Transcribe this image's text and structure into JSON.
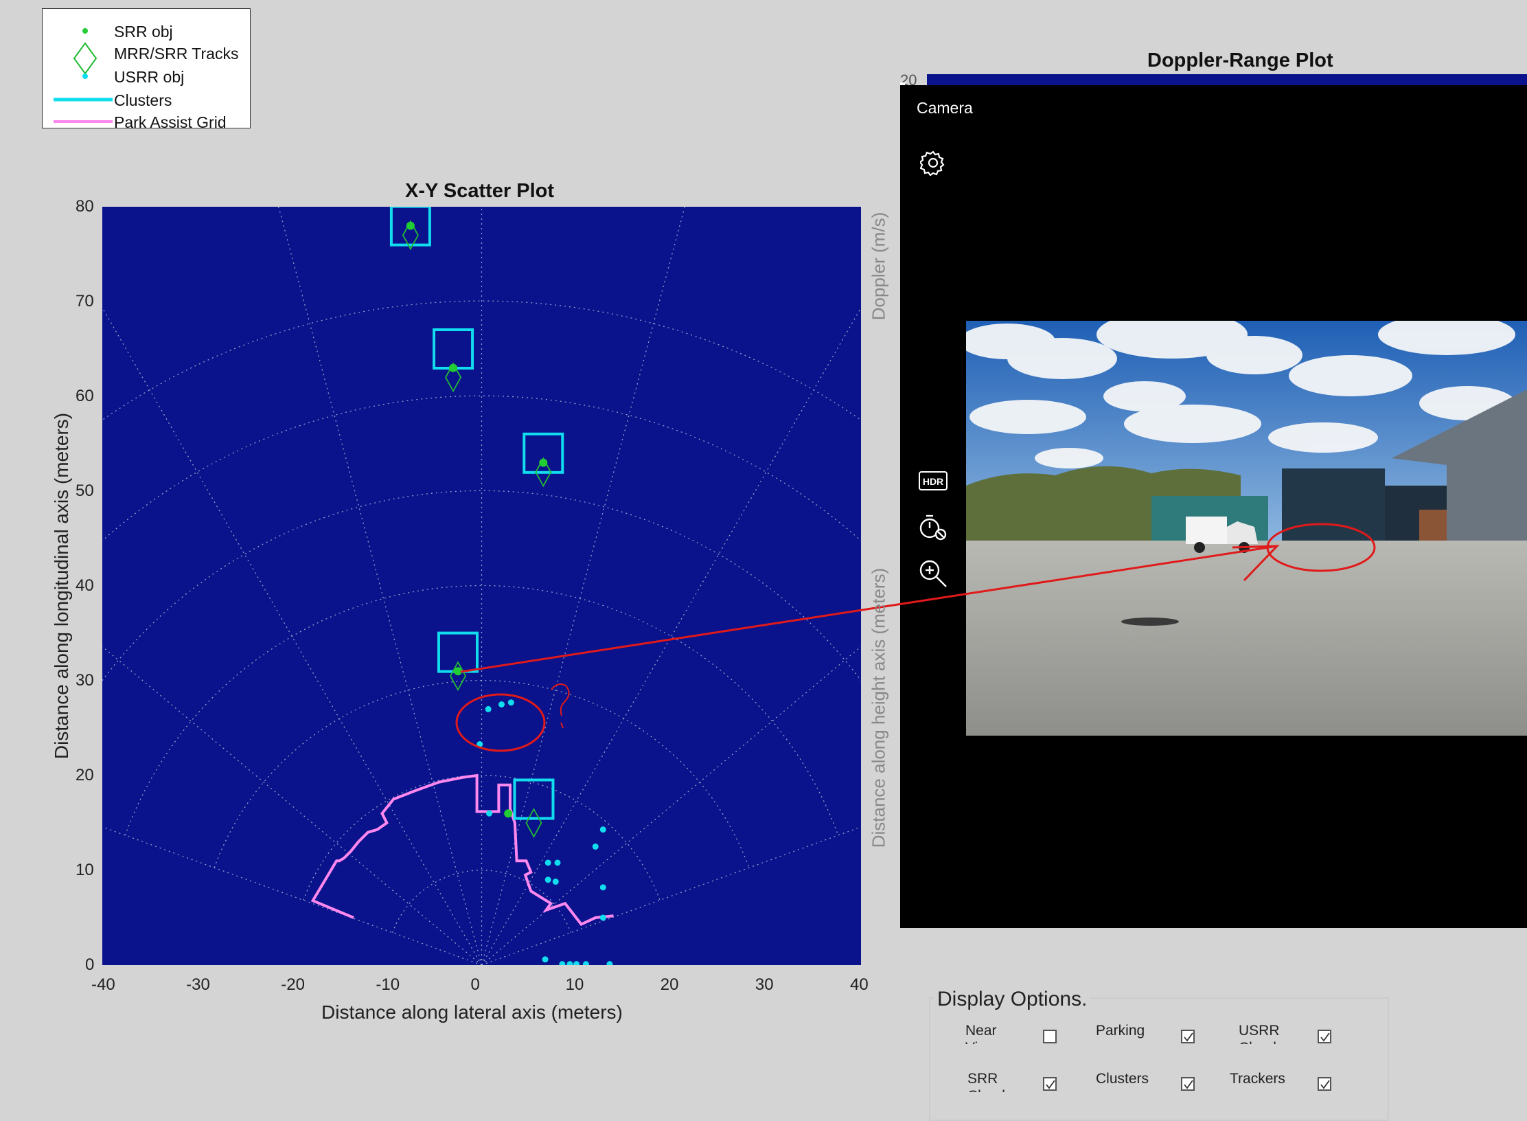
{
  "legend": {
    "items": [
      {
        "label": "SRR obj",
        "icon": "green-dot"
      },
      {
        "label": "MRR/SRR Tracks",
        "icon": "green-diamond"
      },
      {
        "label": "USRR obj",
        "icon": "cyan-dot"
      },
      {
        "label": "Clusters",
        "icon": "cyan-line"
      },
      {
        "label": "Park Assist Grid",
        "icon": "pink-line"
      }
    ]
  },
  "xy_plot": {
    "title": "X-Y Scatter Plot",
    "xlabel": "Distance along lateral axis (meters)",
    "ylabel": "Distance along longitudinal axis (meters)"
  },
  "doppler_plot": {
    "title": "Doppler-Range Plot",
    "top_tick": "20",
    "ylabel": "Doppler (m/s)"
  },
  "height_axis": {
    "ylabel": "Distance along height axis (meters)"
  },
  "camera": {
    "title": "Camera",
    "icons": [
      "gear-icon",
      "hdr-icon",
      "timer-off-icon",
      "zoom-in-icon"
    ]
  },
  "display_options": {
    "title": "Display Options.",
    "options": [
      {
        "label": "Near View",
        "checked": false
      },
      {
        "label": "Parking",
        "checked": true
      },
      {
        "label": "USRR Cloud",
        "checked": true
      },
      {
        "label": "SRR Cloud",
        "checked": true
      },
      {
        "label": "Clusters",
        "checked": true
      },
      {
        "label": "Trackers",
        "checked": true
      }
    ]
  },
  "colors": {
    "plot_bg": "#0a128c",
    "srr": "#22cc33",
    "track": "#22bb33",
    "usrr": "#11ddee",
    "cluster": "#11ddee",
    "park": "#ff88ee",
    "annotation": "#e01a1a"
  },
  "chart_data": {
    "type": "scatter",
    "title": "X-Y Scatter Plot",
    "xlabel": "Distance along lateral axis (meters)",
    "ylabel": "Distance along longitudinal axis (meters)",
    "xlim": [
      -40,
      40
    ],
    "ylim": [
      0,
      80
    ],
    "xticks": [
      -40,
      -30,
      -20,
      -10,
      0,
      10,
      20,
      30,
      40
    ],
    "yticks": [
      0,
      10,
      20,
      30,
      40,
      50,
      60,
      70,
      80
    ],
    "grid": "polar",
    "series": [
      {
        "name": "SRR obj",
        "points": [
          [
            -7.5,
            78
          ],
          [
            -3,
            63
          ],
          [
            6.5,
            53
          ],
          [
            -2.5,
            31
          ],
          [
            2.8,
            16
          ]
        ]
      },
      {
        "name": "MRR/SRR Tracks",
        "points": [
          [
            -7.5,
            77
          ],
          [
            -3,
            62
          ],
          [
            6.5,
            52
          ],
          [
            -2.5,
            30.5
          ],
          [
            5.5,
            15
          ]
        ]
      },
      {
        "name": "USRR obj",
        "points": [
          [
            0.7,
            27
          ],
          [
            2.1,
            27.5
          ],
          [
            3.1,
            27.7
          ],
          [
            -0.2,
            23.3
          ],
          [
            12.8,
            14.3
          ],
          [
            12,
            12.5
          ],
          [
            7,
            10.8
          ],
          [
            8,
            10.8
          ],
          [
            7,
            9
          ],
          [
            7.8,
            8.8
          ],
          [
            12.8,
            8.2
          ],
          [
            12.8,
            5
          ],
          [
            6.7,
            0.6
          ],
          [
            8.5,
            0.1
          ],
          [
            9.3,
            0.1
          ],
          [
            10,
            0.1
          ],
          [
            11,
            0.1
          ],
          [
            13.5,
            0.1
          ],
          [
            0.8,
            16
          ]
        ]
      },
      {
        "name": "Clusters",
        "boxes": [
          [
            -7.5,
            78
          ],
          [
            -3,
            65
          ],
          [
            6.5,
            54
          ],
          [
            -2.5,
            33
          ],
          [
            5.5,
            17.5
          ]
        ]
      },
      {
        "name": "Park Assist Grid",
        "points": [
          [
            -13.5,
            5
          ],
          [
            -17.8,
            6.8
          ],
          [
            -15.3,
            11
          ],
          [
            -15,
            11
          ],
          [
            -14.5,
            11.3
          ],
          [
            -14,
            11.8
          ],
          [
            -13.8,
            12
          ],
          [
            -13,
            13
          ],
          [
            -12,
            14
          ],
          [
            -11,
            14.3
          ],
          [
            -10,
            15
          ],
          [
            -10.5,
            16
          ],
          [
            -9.3,
            17.5
          ],
          [
            -7,
            18.4
          ],
          [
            -4.5,
            19.3
          ],
          [
            -2,
            19.8
          ],
          [
            -0.5,
            20
          ],
          [
            -0.5,
            16.2
          ],
          [
            1.8,
            16.2
          ],
          [
            1.8,
            19
          ],
          [
            3,
            19
          ],
          [
            3,
            16.5
          ],
          [
            3.5,
            15
          ],
          [
            3.7,
            11
          ],
          [
            4.7,
            11
          ],
          [
            5.2,
            9.8
          ],
          [
            4.6,
            9.5
          ],
          [
            5.2,
            7.8
          ],
          [
            7.3,
            6.5
          ],
          [
            6.8,
            5.8
          ],
          [
            8.8,
            6.5
          ],
          [
            10.5,
            4.3
          ],
          [
            12,
            5
          ],
          [
            13.9,
            5.2
          ]
        ]
      }
    ]
  }
}
